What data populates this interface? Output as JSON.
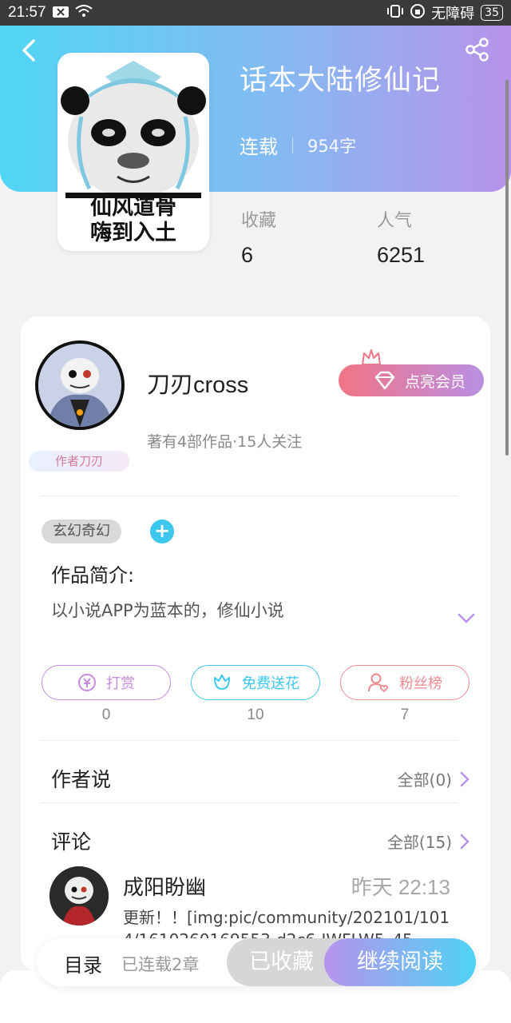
{
  "status_bar": {
    "time": "21:57",
    "accessibility": "无障碍",
    "battery": "35"
  },
  "book": {
    "title": "话本大陆修仙记",
    "status": "连载",
    "word_count": "954字",
    "cover_caption_line1": "仙风道骨",
    "cover_caption_line2": "嗨到入土",
    "stats": [
      {
        "label": "收藏",
        "value": "6"
      },
      {
        "label": "人气",
        "value": "6251"
      }
    ]
  },
  "author": {
    "name": "刀刃cross",
    "meta": "著有4部作品·15人关注",
    "tag": "作者刀刃",
    "vip_button": "点亮会员"
  },
  "genre": {
    "tag": "玄幻奇幻",
    "add": "+"
  },
  "intro": {
    "title": "作品简介:",
    "text": "以小说APP为蓝本的，修仙小说"
  },
  "actions": [
    {
      "label": "打赏",
      "count": "0",
      "color": "#c78ae0",
      "icon": "yen-icon"
    },
    {
      "label": "免费送花",
      "count": "10",
      "color": "#3ec7ee",
      "icon": "flower-icon"
    },
    {
      "label": "粉丝榜",
      "count": "7",
      "color": "#f08a92",
      "icon": "fan-icon"
    }
  ],
  "author_says": {
    "title": "作者说",
    "link": "全部(0)"
  },
  "comments": {
    "title": "评论",
    "link": "全部(15)",
    "items": [
      {
        "name": "成阳盼幽",
        "time": "昨天 22:13",
        "text": "更新！！[img:pic/community/202101/1014/1610260169553-d2c6-IWFLW5_45..."
      }
    ]
  },
  "bottom_bar": {
    "toc": "目录",
    "chapters": "已连载2章",
    "favorited": "已收藏",
    "continue": "继续阅读"
  },
  "colors": {
    "header_start": "#4fd6f4",
    "header_end": "#b793ea",
    "accent_cyan": "#3ec7ee",
    "accent_pink": "#f27486"
  }
}
